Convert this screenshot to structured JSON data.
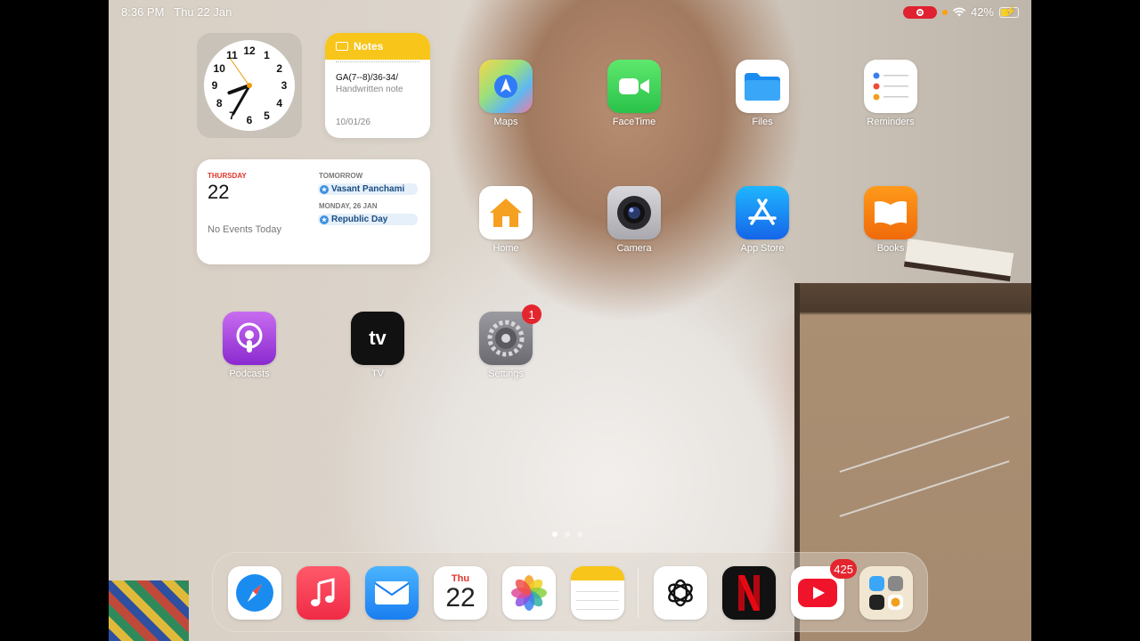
{
  "status_bar": {
    "time": "8:36 PM",
    "date": "Thu 22 Jan",
    "battery": "42%",
    "battery_level": 0.42
  },
  "widgets": {
    "notes": {
      "header": "Notes",
      "note_title": "GA(7--8)/36-34/",
      "note_sub": "Handwritten note",
      "note_date": "10/01/26"
    },
    "calendar": {
      "weekday": "THURSDAY",
      "day": "22",
      "no_events": "No Events Today",
      "tomorrow_label": "TOMORROW",
      "tomorrow_event": "Vasant Panchami",
      "next_label": "MONDAY, 26 JAN",
      "next_event": "Republic Day"
    },
    "clock": {
      "numbers": [
        "12",
        "1",
        "2",
        "3",
        "4",
        "5",
        "6",
        "7",
        "8",
        "9",
        "10",
        "11"
      ]
    }
  },
  "apps": {
    "maps": "Maps",
    "facetime": "FaceTime",
    "files": "Files",
    "reminders": "Reminders",
    "home": "Home",
    "camera": "Camera",
    "appstore": "App Store",
    "books": "Books",
    "podcasts": "Podcasts",
    "tv": "TV",
    "settings": "Settings",
    "settings_badge": "1"
  },
  "dock": {
    "calendar_weekday": "Thu",
    "calendar_day": "22",
    "youtube_badge": "425",
    "tv_icon_text": "tv"
  },
  "colors": {
    "badge": "#e4252e",
    "notes_yellow": "#f8c51b",
    "calendar_red": "#e0342b"
  }
}
